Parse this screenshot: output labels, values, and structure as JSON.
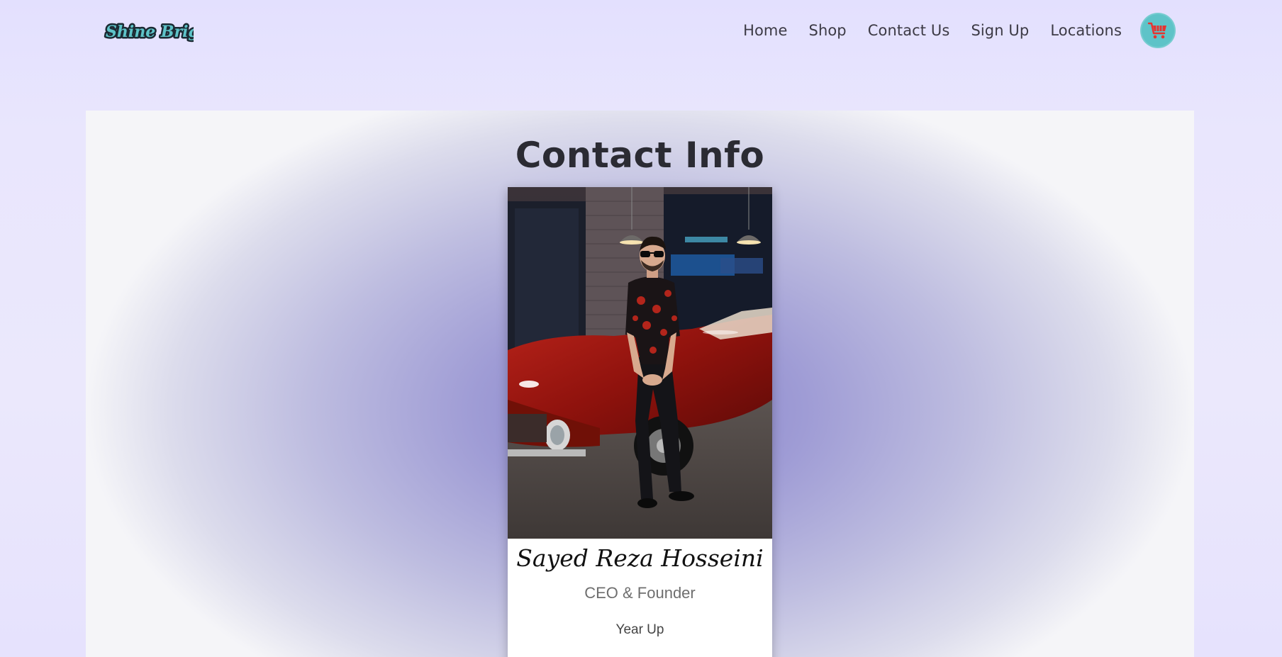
{
  "brand": {
    "logo_text": "Shine Brighter"
  },
  "nav": {
    "items": [
      {
        "label": "Home"
      },
      {
        "label": "Shop"
      },
      {
        "label": "Contact Us"
      },
      {
        "label": "Sign Up"
      },
      {
        "label": "Locations"
      }
    ],
    "cart_icon": "shopping-cart-icon"
  },
  "main": {
    "title": "Contact Info",
    "card": {
      "name": "Sayed Reza Hosseini",
      "role": "CEO & Founder",
      "organization": "Year Up"
    }
  },
  "colors": {
    "cart_bg": "#5ec3c8",
    "cart_icon": "#e8332f",
    "logo_fill": "#5ec3c8"
  }
}
